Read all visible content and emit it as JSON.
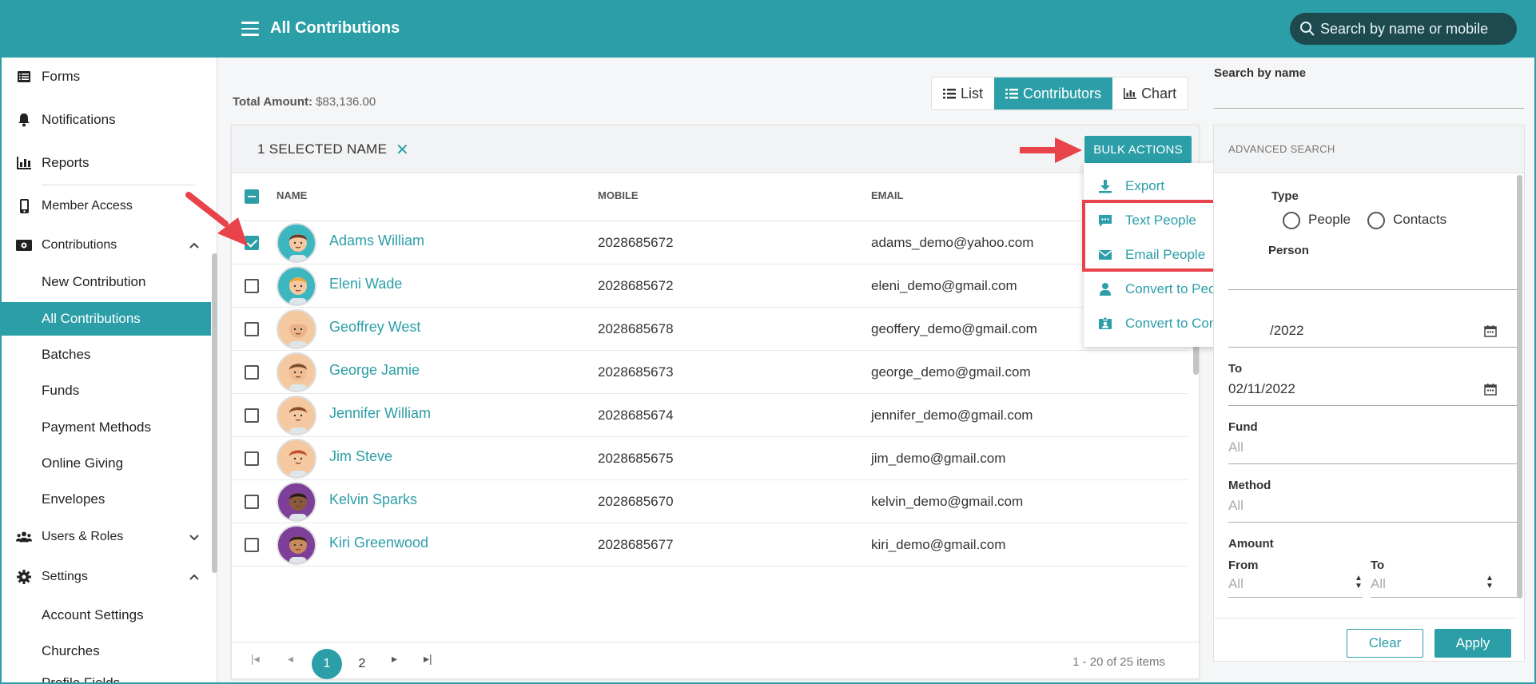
{
  "header": {
    "title": "All Contributions",
    "search_placeholder": "Search by name or mobile"
  },
  "sidebar": {
    "items": [
      {
        "label": "Forms",
        "icon": "list-icon"
      },
      {
        "label": "Notifications",
        "icon": "bell-icon"
      },
      {
        "label": "Reports",
        "icon": "bar-chart-icon"
      },
      {
        "label": "Member Access",
        "icon": "mobile-icon"
      },
      {
        "label": "Contributions",
        "icon": "money-icon",
        "expanded": true
      },
      {
        "label": "Users & Roles",
        "icon": "users-icon",
        "expanded": false
      },
      {
        "label": "Settings",
        "icon": "gear-icon",
        "expanded": true
      }
    ],
    "contributions_sub": [
      "New Contribution",
      "All Contributions",
      "Batches",
      "Funds",
      "Payment Methods",
      "Online Giving",
      "Envelopes"
    ],
    "active_sub": "All Contributions",
    "settings_sub": [
      "Account Settings",
      "Churches",
      "Profile Fields"
    ]
  },
  "main": {
    "total_label": "Total Amount:",
    "total_value": "$83,136.00",
    "views": [
      "List",
      "Contributors",
      "Chart"
    ],
    "active_view": "Contributors",
    "selected_text": "1 SELECTED NAME",
    "bulk_actions_label": "BULK ACTIONS",
    "columns": [
      "NAME",
      "MOBILE",
      "EMAIL"
    ],
    "rows": [
      {
        "name": "Adams William",
        "mobile": "2028685672",
        "email": "adams_demo@yahoo.com",
        "checked": true,
        "avatar_bg": "#3cb7c0"
      },
      {
        "name": "Eleni Wade",
        "mobile": "2028685672",
        "email": "eleni_demo@gmail.com",
        "checked": false,
        "avatar_bg": "#3cb7c0"
      },
      {
        "name": "Geoffrey West",
        "mobile": "2028685678",
        "email": "geoffery_demo@gmail.com",
        "checked": false,
        "avatar_bg": "#f4c9a0"
      },
      {
        "name": "George Jamie",
        "mobile": "2028685673",
        "email": "george_demo@gmail.com",
        "checked": false,
        "avatar_bg": "#f4c9a0"
      },
      {
        "name": "Jennifer William",
        "mobile": "2028685674",
        "email": "jennifer_demo@gmail.com",
        "checked": false,
        "avatar_bg": "#f4c9a0"
      },
      {
        "name": "Jim Steve",
        "mobile": "2028685675",
        "email": "jim_demo@gmail.com",
        "checked": false,
        "avatar_bg": "#f4c9a0"
      },
      {
        "name": "Kelvin Sparks",
        "mobile": "2028685670",
        "email": "kelvin_demo@gmail.com",
        "checked": false,
        "avatar_bg": "#7d3f98"
      },
      {
        "name": "Kiri Greenwood",
        "mobile": "2028685677",
        "email": "kiri_demo@gmail.com",
        "checked": false,
        "avatar_bg": "#7d3f98"
      }
    ],
    "pagination": {
      "pages": [
        "1",
        "2"
      ],
      "current": "1",
      "info": "1 - 20 of 25 items"
    }
  },
  "bulk_menu": [
    {
      "label": "Export",
      "icon": "download-icon"
    },
    {
      "label": "Text People",
      "icon": "chat-icon"
    },
    {
      "label": "Email People",
      "icon": "envelope-icon"
    },
    {
      "label": "Convert to People",
      "icon": "person-icon"
    },
    {
      "label": "Convert to Contacts",
      "icon": "contact-card-icon"
    }
  ],
  "right_panel": {
    "search_by_name_label": "Search by name",
    "advanced_search_label": "ADVANCED SEARCH",
    "type_label_partial": "Type",
    "type_options": [
      "People",
      "Contacts"
    ],
    "person_label_partial": "Person",
    "from_date_partial": "/2022",
    "to_label": "To",
    "to_date": "02/11/2022",
    "fund_label": "Fund",
    "fund_value": "All",
    "method_label": "Method",
    "method_value": "All",
    "amount_label": "Amount",
    "amount_from_label": "From",
    "amount_from_value": "All",
    "amount_to_label": "To",
    "amount_to_value": "All",
    "clear_label": "Clear",
    "apply_label": "Apply"
  },
  "colors": {
    "accent": "#2b9ea8",
    "highlight": "#e8424a"
  }
}
